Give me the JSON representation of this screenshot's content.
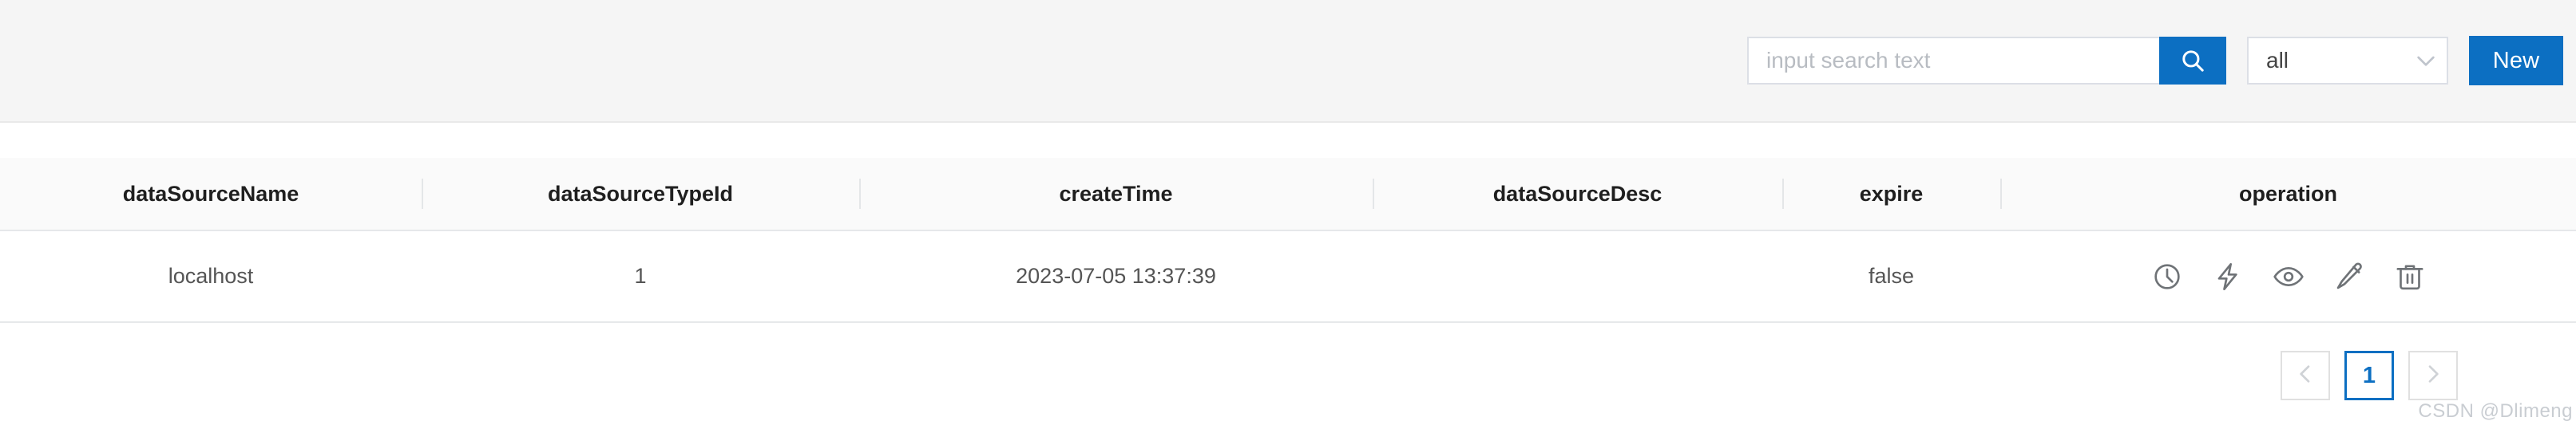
{
  "theme": {
    "accent": "#0c6fc2",
    "toolbar_bg": "#f5f5f5",
    "header_bg": "#fafafa",
    "row_bg": "#ffffff",
    "border": "#e6e8ea",
    "text": "#1f1f1f",
    "muted_text": "#555555",
    "placeholder": "#b8bcc2",
    "icon": "#6f7377",
    "disabled_chevron": "#cfd2d6",
    "watermark": "#c9cdd2"
  },
  "toolbar": {
    "search": {
      "value": "",
      "placeholder": "input search text",
      "button_icon": "search-icon"
    },
    "filter_select": {
      "selected": "all",
      "options": [
        "all"
      ],
      "chevron_icon": "chevron-down-icon"
    },
    "new_button": {
      "label": "New"
    }
  },
  "table": {
    "columns": [
      {
        "key": "dataSourceName",
        "label": "dataSourceName"
      },
      {
        "key": "dataSourceTypeId",
        "label": "dataSourceTypeId"
      },
      {
        "key": "createTime",
        "label": "createTime"
      },
      {
        "key": "dataSourceDesc",
        "label": "dataSourceDesc"
      },
      {
        "key": "expire",
        "label": "expire"
      },
      {
        "key": "operation",
        "label": "operation"
      }
    ],
    "rows": [
      {
        "dataSourceName": "localhost",
        "dataSourceTypeId": "1",
        "createTime": "2023-07-05 13:37:39",
        "dataSourceDesc": "",
        "expire": "false",
        "operations": [
          {
            "name": "history-clock-icon",
            "title": "history"
          },
          {
            "name": "lightning-bolt-icon",
            "title": "test"
          },
          {
            "name": "eye-icon",
            "title": "view"
          },
          {
            "name": "pencil-icon",
            "title": "edit"
          },
          {
            "name": "trash-icon",
            "title": "delete"
          }
        ]
      }
    ]
  },
  "pagination": {
    "prev_icon": "chevron-left-icon",
    "next_icon": "chevron-right-icon",
    "pages": [
      "1"
    ],
    "current_page": "1",
    "prev_disabled": true,
    "next_disabled": true
  },
  "watermark": {
    "text": "CSDN @Dlimeng"
  }
}
